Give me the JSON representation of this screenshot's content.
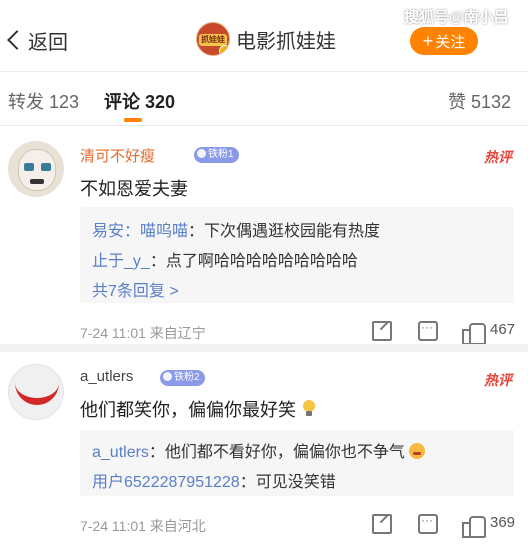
{
  "header": {
    "back_label": "返回",
    "account_name": "电影抓娃娃",
    "account_logo_text": "抓娃娃",
    "follow_label": "关注",
    "follow_plus": "+",
    "watermark": "搜狐号@南小吕"
  },
  "tabs": [
    {
      "label": "转发 123"
    },
    {
      "label": "评论 320"
    },
    {
      "label": "赞 5132"
    }
  ],
  "comments": [
    {
      "username": "清可不好瘦",
      "fan_badge": "铁粉1",
      "hot_tag": "热评",
      "text": "不如恩爱夫妻",
      "replies": [
        {
          "name": "易安：喵呜喵",
          "body": "：下次偶遇逛校园能有热度"
        },
        {
          "name": "止于_y_",
          "body": "：点了啊哈哈哈哈哈哈哈哈哈"
        }
      ],
      "more": "共7条回复 >",
      "time_location": "7-24 11:01 来自辽宁",
      "likes": "467"
    },
    {
      "username": "a_utlers",
      "fan_badge": "铁粉2",
      "hot_tag": "热评",
      "text": "他们都笑你，偏偏你最好笑",
      "replies": [
        {
          "name": "a_utlers",
          "body": "：他们都不看好你，偏偏你也不争气"
        },
        {
          "name": "用户6522287951228",
          "body": "：可见没笑错"
        }
      ],
      "time_location": "7-24 11:01 来自河北",
      "likes": "369"
    }
  ],
  "colors": {
    "accent": "#ff8200",
    "link": "#5a7fc8",
    "hot": "#e8453c"
  }
}
